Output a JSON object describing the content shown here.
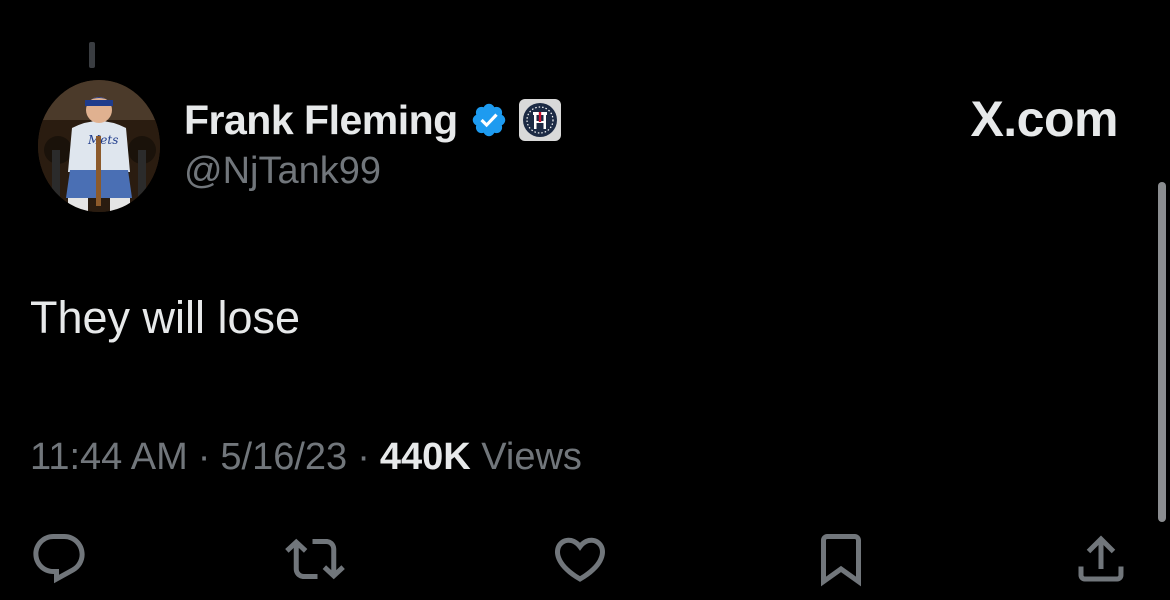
{
  "author": {
    "display_name": "Frank Fleming",
    "handle": "@NjTank99",
    "verified_badge_icon": "verified-check-icon",
    "affiliate_badge_icon": "barstool-affiliate-icon",
    "verified_color": "#1d9bf0"
  },
  "brand": {
    "label": "X.com"
  },
  "tweet": {
    "text": "They will lose",
    "time": "11:44 AM",
    "separator": "·",
    "date": "5/16/23",
    "views_count": "440K",
    "views_label": "Views"
  },
  "actions": [
    {
      "icon": "reply-icon"
    },
    {
      "icon": "retweet-icon"
    },
    {
      "icon": "like-icon"
    },
    {
      "icon": "bookmark-icon"
    },
    {
      "icon": "share-icon"
    }
  ],
  "colors": {
    "background": "#000000",
    "primary_text": "#e7e9ea",
    "secondary_text": "#71767b"
  }
}
